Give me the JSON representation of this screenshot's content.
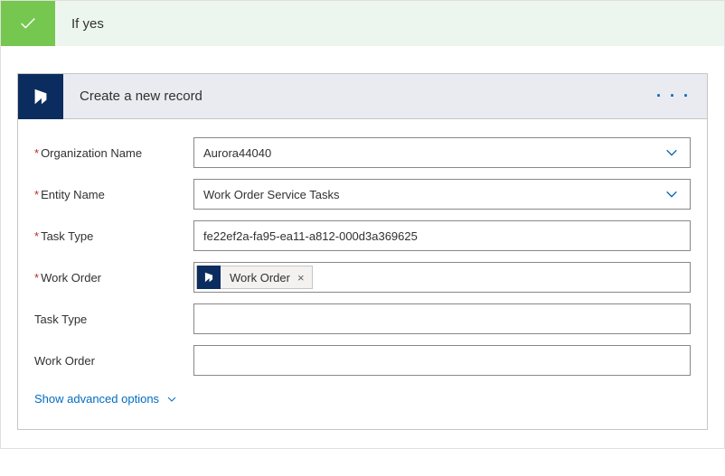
{
  "condition": {
    "title": "If yes"
  },
  "action": {
    "title": "Create a new record",
    "menu_glyph": "· · ·"
  },
  "fields": {
    "organization": {
      "label": "Organization Name",
      "value": "Aurora44040",
      "required": true
    },
    "entity": {
      "label": "Entity Name",
      "value": "Work Order Service Tasks",
      "required": true
    },
    "tasktype_req": {
      "label": "Task Type",
      "value": "fe22ef2a-fa95-ea11-a812-000d3a369625",
      "required": true
    },
    "workorder_req": {
      "label": "Work Order",
      "token_label": "Work Order",
      "token_remove": "×",
      "required": true
    },
    "tasktype_opt": {
      "label": "Task Type",
      "value": "",
      "required": false
    },
    "workorder_opt": {
      "label": "Work Order",
      "value": "",
      "required": false
    }
  },
  "advanced": {
    "label": "Show advanced options"
  }
}
